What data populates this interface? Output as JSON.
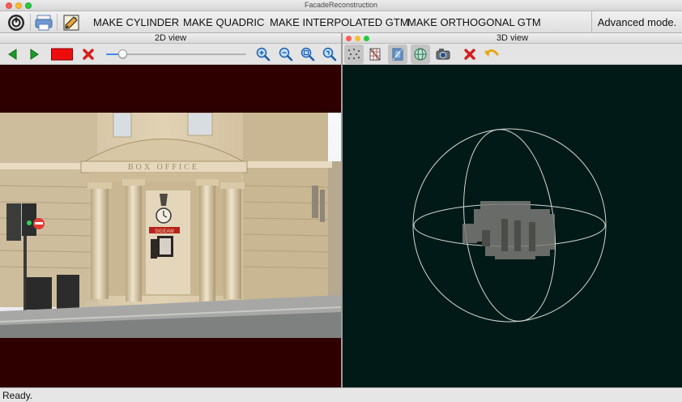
{
  "window": {
    "title": "FacadeReconstruction"
  },
  "toolbar": {
    "buttons": [
      "MAKE CYLINDER",
      "MAKE QUADRIC",
      "MAKE INTERPOLATED GTM",
      "MAKE ORTHOGONAL GTM"
    ],
    "advanced_label": "Advanced mode."
  },
  "view2d": {
    "title": "2D view",
    "zoom_slider_value": 0.12,
    "photo": {
      "sign_text": "BOX OFFICE",
      "red_sign_text": "SIGEAW"
    }
  },
  "view3d": {
    "title": "3D view"
  },
  "colors": {
    "view2d_bg": "#2e0000",
    "view3d_bg": "#011a17",
    "accent_blue": "#3d8af7",
    "delete_red": "#d81c1c"
  },
  "status": {
    "text": "Ready."
  }
}
